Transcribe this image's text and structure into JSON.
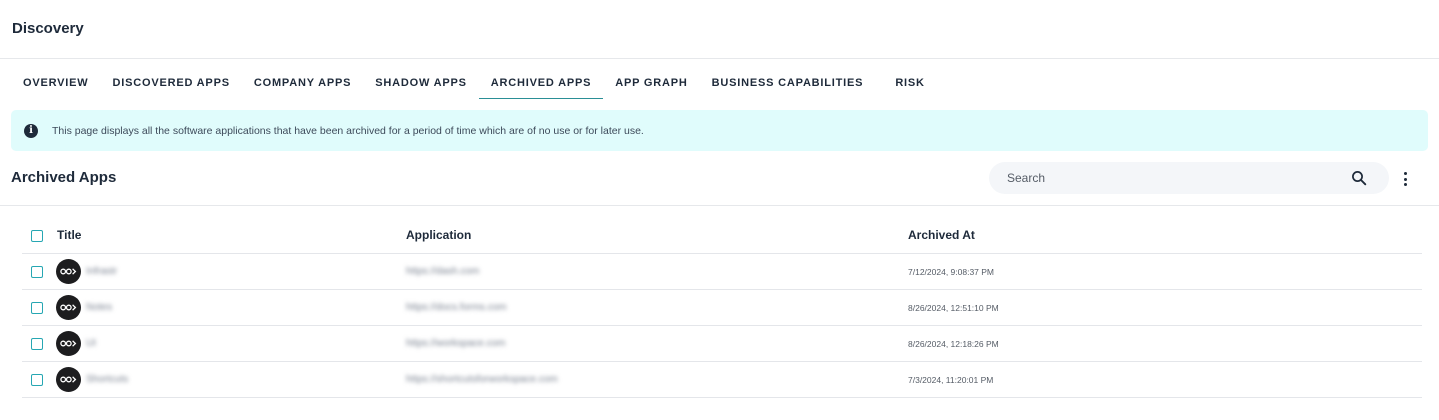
{
  "header": {
    "title": "Discovery"
  },
  "tabs": [
    {
      "label": "OVERVIEW",
      "active": false
    },
    {
      "label": "DISCOVERED APPS",
      "active": false
    },
    {
      "label": "COMPANY APPS",
      "active": false
    },
    {
      "label": "SHADOW APPS",
      "active": false
    },
    {
      "label": "ARCHIVED APPS",
      "active": true
    },
    {
      "label": "APP GRAPH",
      "active": false
    },
    {
      "label": "BUSINESS CAPABILITIES",
      "active": false
    },
    {
      "label": "RISK",
      "active": false
    }
  ],
  "banner": {
    "icon": "info-icon",
    "message": "This page displays all the software applications that have been archived for a period of time which are of no use or for later use."
  },
  "section": {
    "title": "Archived Apps"
  },
  "search": {
    "placeholder": "Search",
    "value": "",
    "icon": "search-icon"
  },
  "menu": {
    "icon": "kebab-menu-icon"
  },
  "table": {
    "columns": [
      "Title",
      "Application",
      "Archived At"
    ],
    "rows": [
      {
        "title": "Infrastr",
        "application": "https://dash.com",
        "archived_at": "7/12/2024, 9:08:37 PM"
      },
      {
        "title": "Notes",
        "application": "https://docs.forms.com",
        "archived_at": "8/26/2024, 12:51:10 PM"
      },
      {
        "title": "UI",
        "application": "https://workspace.com",
        "archived_at": "8/26/2024, 12:18:26 PM"
      },
      {
        "title": "Shortcuts",
        "application": "https://shortcutsforworkspace.com",
        "archived_at": "7/3/2024, 11:20:01 PM"
      }
    ]
  },
  "colors": {
    "accent": "#2a8f96",
    "banner_bg": "#e0fcfc",
    "checkbox": "#26a7b3",
    "text": "#1e2a3a"
  }
}
